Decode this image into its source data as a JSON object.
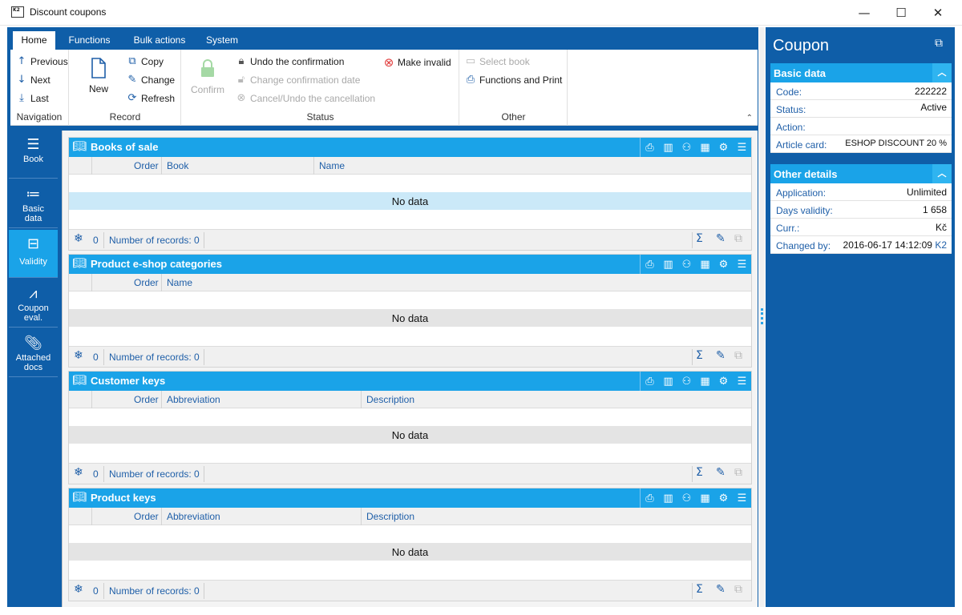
{
  "window": {
    "title": "Discount coupons",
    "app_icon_text": "K2",
    "controls": [
      "—",
      "☐",
      "✕"
    ]
  },
  "ribbon": {
    "tabs": [
      "Home",
      "Functions",
      "Bulk actions",
      "System"
    ],
    "active_tab": "Home",
    "groups": {
      "navigation": {
        "label": "Navigation",
        "previous": "Previous",
        "next": "Next",
        "last": "Last"
      },
      "record": {
        "label": "Record",
        "new": "New",
        "copy": "Copy",
        "change": "Change",
        "refresh": "Refresh"
      },
      "status": {
        "label": "Status",
        "confirm": "Confirm",
        "undo_confirmation": "Undo the confirmation",
        "change_confirmation_date": "Change confirmation date",
        "cancel_undo": "Cancel/Undo the cancellation",
        "make_invalid": "Make invalid"
      },
      "other": {
        "label": "Other",
        "select_book": "Select book",
        "functions_print": "Functions and Print"
      }
    }
  },
  "sidenav": [
    {
      "label": "Book",
      "icon": "menu-icon",
      "active": false
    },
    {
      "label": "Basic data",
      "icon": "list-icon",
      "active": false
    },
    {
      "label": "Validity",
      "icon": "archive-icon",
      "active": true
    },
    {
      "label": "Coupon eval.",
      "icon": "chart-icon",
      "active": false
    },
    {
      "label": "Attached docs",
      "icon": "paperclip-icon",
      "active": false
    }
  ],
  "panels": [
    {
      "title": "Books of sale",
      "columns": [
        "Order",
        "Book",
        "Name"
      ],
      "empty_text": "No data",
      "count": "0",
      "records_label": "Number of records: 0",
      "highlight": true
    },
    {
      "title": "Product e-shop categories",
      "columns": [
        "Order",
        "Name"
      ],
      "empty_text": "No data",
      "count": "0",
      "records_label": "Number of records: 0",
      "highlight": false
    },
    {
      "title": "Customer keys",
      "columns": [
        "Order",
        "Abbreviation",
        "Description"
      ],
      "empty_text": "No data",
      "count": "0",
      "records_label": "Number of records: 0",
      "highlight": false
    },
    {
      "title": "Product keys",
      "columns": [
        "Order",
        "Abbreviation",
        "Description"
      ],
      "empty_text": "No data",
      "count": "0",
      "records_label": "Number of records: 0",
      "highlight": false
    }
  ],
  "detail": {
    "title": "Coupon",
    "basic": {
      "header": "Basic data",
      "rows": [
        {
          "key": "Code:",
          "value": "222222"
        },
        {
          "key": "Status:",
          "value": "Active"
        },
        {
          "key": "Action:",
          "value": ""
        },
        {
          "key": "Article card:",
          "value": "ESHOP DISCOUNT 20 %"
        }
      ]
    },
    "other": {
      "header": "Other details",
      "rows": [
        {
          "key": "Application:",
          "value": "Unlimited"
        },
        {
          "key": "Days validity:",
          "value": "1 658"
        },
        {
          "key": "Curr.:",
          "value": "Kč"
        },
        {
          "key": "Changed by:",
          "value": "2016-06-17 14:12:09",
          "user": "K2"
        }
      ]
    }
  },
  "colors": {
    "frame": "#0f5ea8",
    "accent": "#1aa3e8",
    "link": "#1f5fa8",
    "invalid": "#e03a3a"
  }
}
